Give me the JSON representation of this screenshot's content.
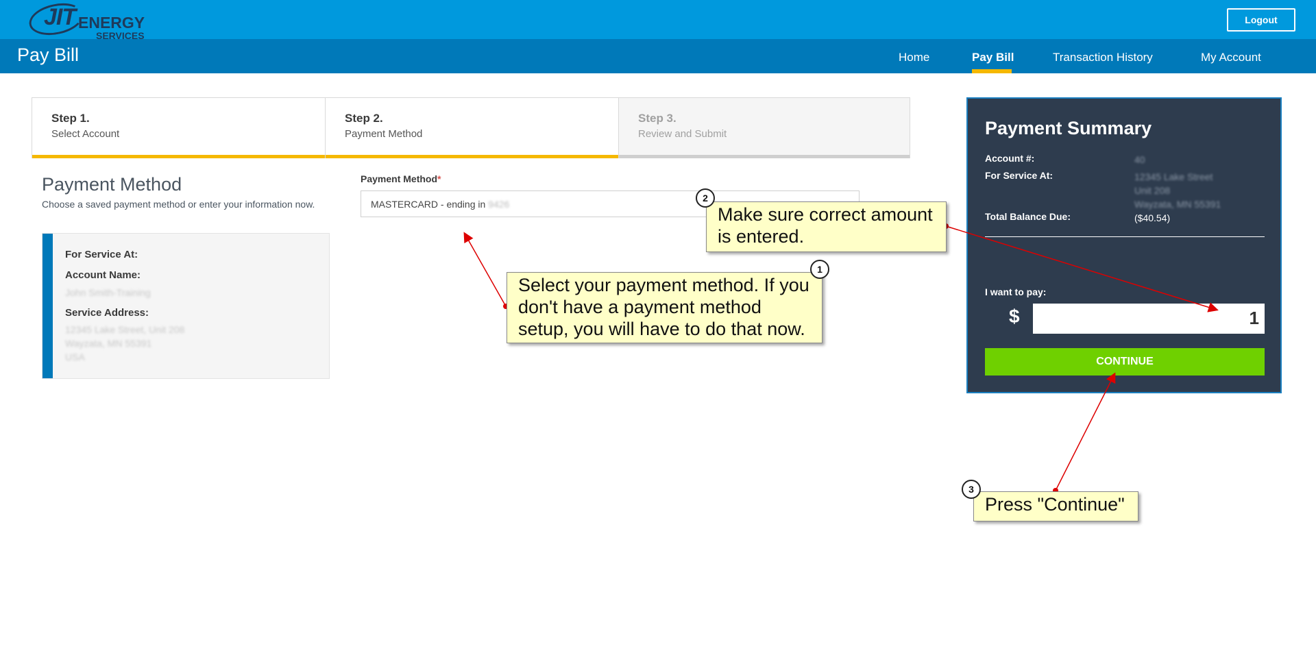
{
  "header": {
    "logo": {
      "main": "JIT",
      "energy": "ENERGY",
      "services": "SERVICES"
    },
    "logout_label": "Logout"
  },
  "nav": {
    "page_title": "Pay Bill",
    "items": [
      {
        "label": "Home"
      },
      {
        "label": "Pay Bill"
      },
      {
        "label": "Transaction History"
      },
      {
        "label": "My Account"
      }
    ]
  },
  "steps": [
    {
      "title": "Step 1.",
      "subtitle": "Select Account"
    },
    {
      "title": "Step 2.",
      "subtitle": "Payment Method"
    },
    {
      "title": "Step 3.",
      "subtitle": "Review and Submit"
    }
  ],
  "payment_method_section": {
    "heading": "Payment Method",
    "description": "Choose a saved payment method or enter your information now.",
    "service_box": {
      "for_service_at_label": "For Service At:",
      "account_name_label": "Account Name:",
      "account_name_value": "John Smith-Training",
      "service_address_label": "Service Address:",
      "address_line1": "12345 Lake Street, Unit 208",
      "address_line2": "Wayzata, MN 55391",
      "address_line3": "USA"
    }
  },
  "payment_method_field": {
    "label": "Payment Method",
    "required_mark": "*",
    "selected_value": "MASTERCARD - ending in",
    "selected_suffix": "9426"
  },
  "summary": {
    "title": "Payment Summary",
    "account_label": "Account #:",
    "account_value": "40",
    "service_label": "For Service At:",
    "service_line1": "12345 Lake Street",
    "service_line2": "Unit 208",
    "service_line3": "Wayzata, MN 55391",
    "balance_label": "Total Balance Due:",
    "balance_value": "($40.54)",
    "pay_label": "I want to pay:",
    "currency": "$",
    "amount": "1",
    "continue_label": "CONTINUE"
  },
  "callouts": [
    {
      "number": "1",
      "text": "Select your payment method. If you don't have a payment method setup, you will have to do that now."
    },
    {
      "number": "2",
      "text": "Make sure correct amount is entered."
    },
    {
      "number": "3",
      "text": "Press \"Continue\""
    }
  ],
  "colors": {
    "topbar": "#0099dd",
    "navbar": "#0079b9",
    "accent": "#f5b800",
    "summary_bg": "#2e3c4e",
    "continue": "#6fd000",
    "callout_bg": "#ffffc8",
    "arrow": "#dd0000"
  }
}
